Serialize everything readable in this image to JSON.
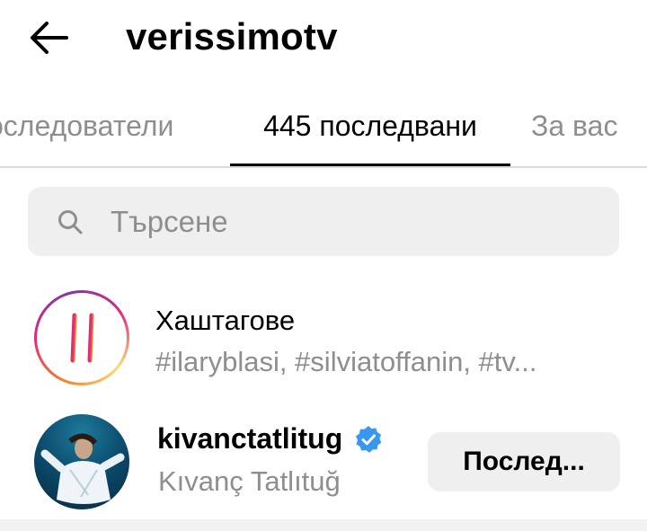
{
  "header": {
    "title": "verissimotv",
    "back_icon": "arrow-left-icon"
  },
  "tabs": [
    {
      "label": "Последователи",
      "visible_text": "оследователи",
      "active": false
    },
    {
      "label": "445 последвани",
      "active": true
    },
    {
      "label": "За вас",
      "active": false
    }
  ],
  "search": {
    "placeholder": "Търсене",
    "value": "",
    "icon": "search-icon"
  },
  "hashtags_row": {
    "title": "Хаштагове",
    "subtitle": "#ilaryblasi, #silviatoffanin, #tv...",
    "icon": "hashtag-icon"
  },
  "users": [
    {
      "username": "kivanctatlitug",
      "full_name": "Kıvanç Tatlıtuğ",
      "verified": true,
      "button_label": "Послед..."
    }
  ],
  "colors": {
    "text_primary": "#000000",
    "text_secondary": "#8e8e8e",
    "button_bg": "#efefef",
    "verified_blue": "#3897f0",
    "divider": "#dbdbdb"
  }
}
